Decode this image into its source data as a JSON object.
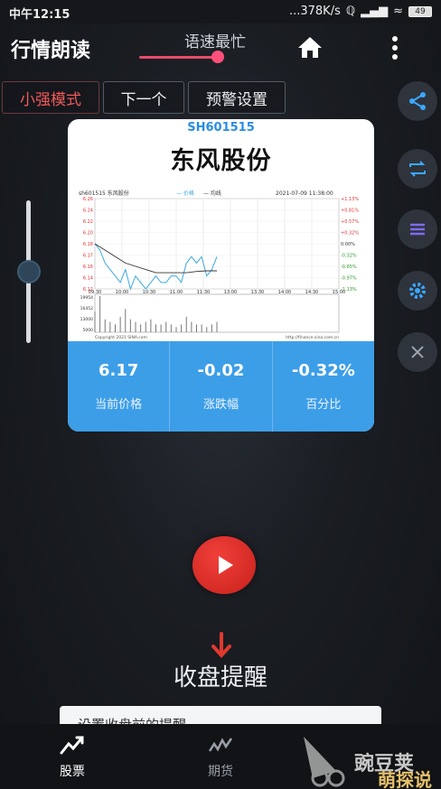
{
  "status_bar": {
    "time": "中午12:15",
    "network_speed": "...378K/s",
    "battery": "49"
  },
  "header": {
    "title": "行情朗读",
    "speed_label": "语速最忙",
    "speed_level": 0.95
  },
  "mode_buttons": {
    "strong_mode": "小强模式",
    "next": "下一个",
    "alert_settings": "预警设置"
  },
  "volume_level": 0.5,
  "stock_card": {
    "code": "SH601515",
    "name": "东风股份",
    "price_value": "6.17",
    "price_label": "当前价格",
    "change_value": "-0.02",
    "change_label": "涨跌幅",
    "percent_value": "-0.32%",
    "percent_label": "百分比"
  },
  "chart_data": {
    "type": "line",
    "title": "sh601515 东风股份",
    "legend": [
      "价格",
      "均线"
    ],
    "date": "2021-07-09 11:38:00",
    "x_ticks": [
      "09:30",
      "10:00",
      "10:30",
      "11:00",
      "11:30",
      "13:00",
      "13:30",
      "14:00",
      "14:30",
      "15:00"
    ],
    "y_left_ticks": [
      "6.26",
      "6.24",
      "6.22",
      "6.20",
      "6.18",
      "6.17",
      "6.16",
      "6.14",
      "6.12"
    ],
    "y_right_ticks": [
      "+1.13%",
      "+0.81%",
      "+0.57%",
      "+0.32%",
      "0.00%",
      "-0.32%",
      "-0.65%",
      "-0.97%",
      "-1.13%"
    ],
    "volume_ticks": [
      "19954",
      "16452",
      "13000",
      "5000"
    ],
    "ylim": [
      6.12,
      6.26
    ],
    "series": [
      {
        "name": "价格",
        "color": "#3aa8e0",
        "x": [
          "09:30",
          "09:35",
          "09:40",
          "09:45",
          "09:50",
          "09:55",
          "10:00",
          "10:05",
          "10:10",
          "10:15",
          "10:20",
          "10:25",
          "10:30",
          "10:35",
          "10:40",
          "10:45",
          "10:50",
          "10:55",
          "11:00",
          "11:05",
          "11:10",
          "11:15",
          "11:20",
          "11:25",
          "11:30"
        ],
        "values": [
          6.19,
          6.18,
          6.16,
          6.15,
          6.14,
          6.13,
          6.15,
          6.12,
          6.14,
          6.13,
          6.12,
          6.13,
          6.14,
          6.13,
          6.13,
          6.14,
          6.14,
          6.13,
          6.16,
          6.17,
          6.16,
          6.17,
          6.14,
          6.15,
          6.17
        ]
      },
      {
        "name": "均线",
        "color": "#333333",
        "x": [
          "09:30",
          "09:40",
          "09:50",
          "10:00",
          "10:10",
          "10:20",
          "10:30",
          "10:40",
          "10:50",
          "11:00",
          "11:10",
          "11:20",
          "11:30"
        ],
        "values": [
          6.19,
          6.18,
          6.17,
          6.16,
          6.155,
          6.15,
          6.145,
          6.145,
          6.145,
          6.145,
          6.147,
          6.148,
          6.148
        ]
      }
    ],
    "volume": [
      8,
      14,
      5,
      4,
      3,
      6,
      9,
      5,
      4,
      3,
      4,
      5,
      3,
      3,
      4,
      3,
      2,
      3,
      6,
      4,
      3,
      3,
      2,
      3,
      4
    ],
    "copyright": "Copyright 2021 SINA.com",
    "source": "http://finance.sina.com.cn"
  },
  "section_title": "收盘提醒",
  "hint_text": "设置收盘前的提醒",
  "bottom_nav": {
    "stocks": "股票",
    "futures": "期货"
  },
  "watermark": {
    "top": "豌豆荚",
    "bottom": "萌探说"
  }
}
